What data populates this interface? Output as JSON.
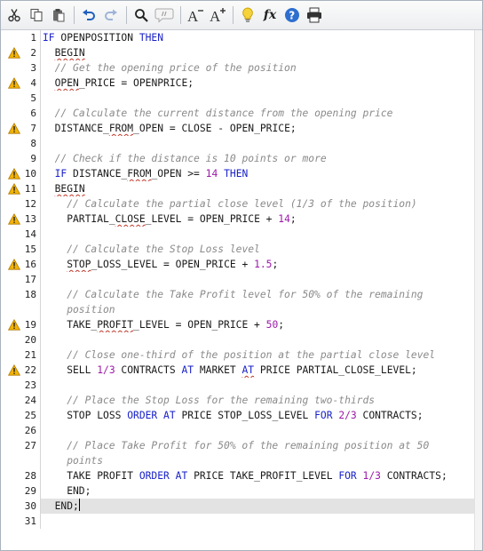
{
  "toolbar": {
    "items": [
      "cut",
      "copy",
      "paste",
      "undo",
      "redo",
      "find",
      "comment",
      "decrease-font",
      "increase-font",
      "idea",
      "function",
      "help",
      "print"
    ],
    "fx_label": "fx"
  },
  "colors": {
    "keyword": "#1a22c8",
    "number": "#9c1aa8",
    "comment": "#8a8a8a",
    "warning": "#f4b400"
  },
  "code_lines": [
    {
      "n": "1",
      "warn": false,
      "text": "IF OPENPOSITION THEN"
    },
    {
      "n": "2",
      "warn": true,
      "text": "BEGIN"
    },
    {
      "n": "3",
      "warn": false,
      "text": "// Get the opening price of the position"
    },
    {
      "n": "4",
      "warn": true,
      "text": "OPEN_PRICE = OPENPRICE;"
    },
    {
      "n": "5",
      "warn": false,
      "text": ""
    },
    {
      "n": "6",
      "warn": false,
      "text": "// Calculate the current distance from the opening price"
    },
    {
      "n": "7",
      "warn": true,
      "text": "DISTANCE_FROM_OPEN = CLOSE - OPEN_PRICE;"
    },
    {
      "n": "8",
      "warn": false,
      "text": ""
    },
    {
      "n": "9",
      "warn": false,
      "text": "// Check if the distance is 10 points or more"
    },
    {
      "n": "10",
      "warn": true,
      "text": "IF DISTANCE_FROM_OPEN >= 14 THEN"
    },
    {
      "n": "11",
      "warn": true,
      "text": "BEGIN"
    },
    {
      "n": "12",
      "warn": false,
      "text": "// Calculate the partial close level (1/3 of the position)"
    },
    {
      "n": "13",
      "warn": true,
      "text": "PARTIAL_CLOSE_LEVEL = OPEN_PRICE + 14;"
    },
    {
      "n": "14",
      "warn": false,
      "text": ""
    },
    {
      "n": "15",
      "warn": false,
      "text": "// Calculate the Stop Loss level"
    },
    {
      "n": "16",
      "warn": true,
      "text": "STOP_LOSS_LEVEL = OPEN_PRICE + 1.5;"
    },
    {
      "n": "17",
      "warn": false,
      "text": ""
    },
    {
      "n": "18",
      "warn": false,
      "text": "// Calculate the Take Profit level for 50% of the remaining position"
    },
    {
      "n": "19",
      "warn": true,
      "text": "TAKE_PROFIT_LEVEL = OPEN_PRICE + 50;"
    },
    {
      "n": "20",
      "warn": false,
      "text": ""
    },
    {
      "n": "21",
      "warn": false,
      "text": "// Close one-third of the position at the partial close level"
    },
    {
      "n": "22",
      "warn": true,
      "text": "SELL 1/3 CONTRACTS AT MARKET AT PRICE PARTIAL_CLOSE_LEVEL;"
    },
    {
      "n": "23",
      "warn": false,
      "text": ""
    },
    {
      "n": "24",
      "warn": false,
      "text": "// Place the Stop Loss for the remaining two-thirds"
    },
    {
      "n": "25",
      "warn": false,
      "text": "STOP LOSS ORDER AT PRICE STOP_LOSS_LEVEL FOR 2/3 CONTRACTS;"
    },
    {
      "n": "26",
      "warn": false,
      "text": ""
    },
    {
      "n": "27",
      "warn": false,
      "text": "// Place Take Profit for 50% of the remaining position at 50 points"
    },
    {
      "n": "28",
      "warn": false,
      "text": "TAKE PROFIT ORDER AT PRICE TAKE_PROFIT_LEVEL FOR 1/3 CONTRACTS;"
    },
    {
      "n": "29",
      "warn": false,
      "text": "END;"
    },
    {
      "n": "30",
      "warn": false,
      "text": "END;"
    },
    {
      "n": "31",
      "warn": false,
      "text": ""
    }
  ]
}
